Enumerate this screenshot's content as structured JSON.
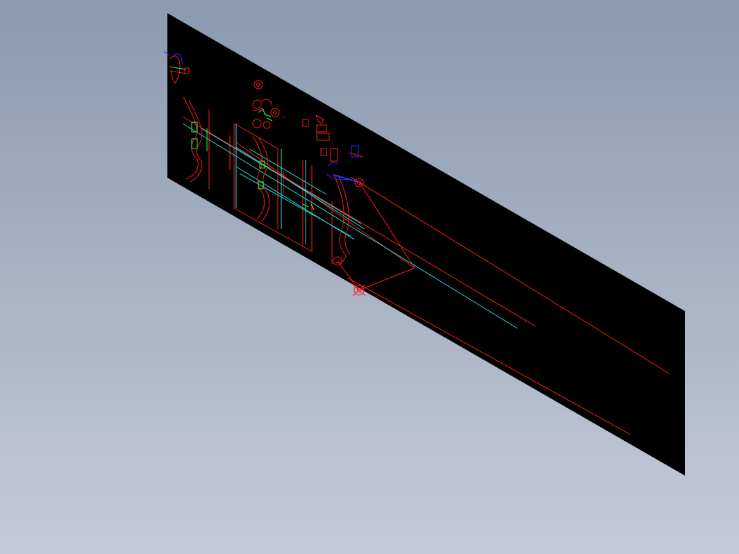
{
  "viewport": {
    "background_top": "#8a9ab0",
    "background_bottom": "#c6cad6"
  },
  "sheet": {
    "fill": "#000000"
  },
  "colors": {
    "red": "#ff1a1a",
    "cyan": "#22e0e0",
    "green": "#33ff33",
    "blue": "#2233ff",
    "white": "#ffffff"
  },
  "icons": [
    "section-cut-icon",
    "circle-detail-icon",
    "ring-arc-icon"
  ]
}
